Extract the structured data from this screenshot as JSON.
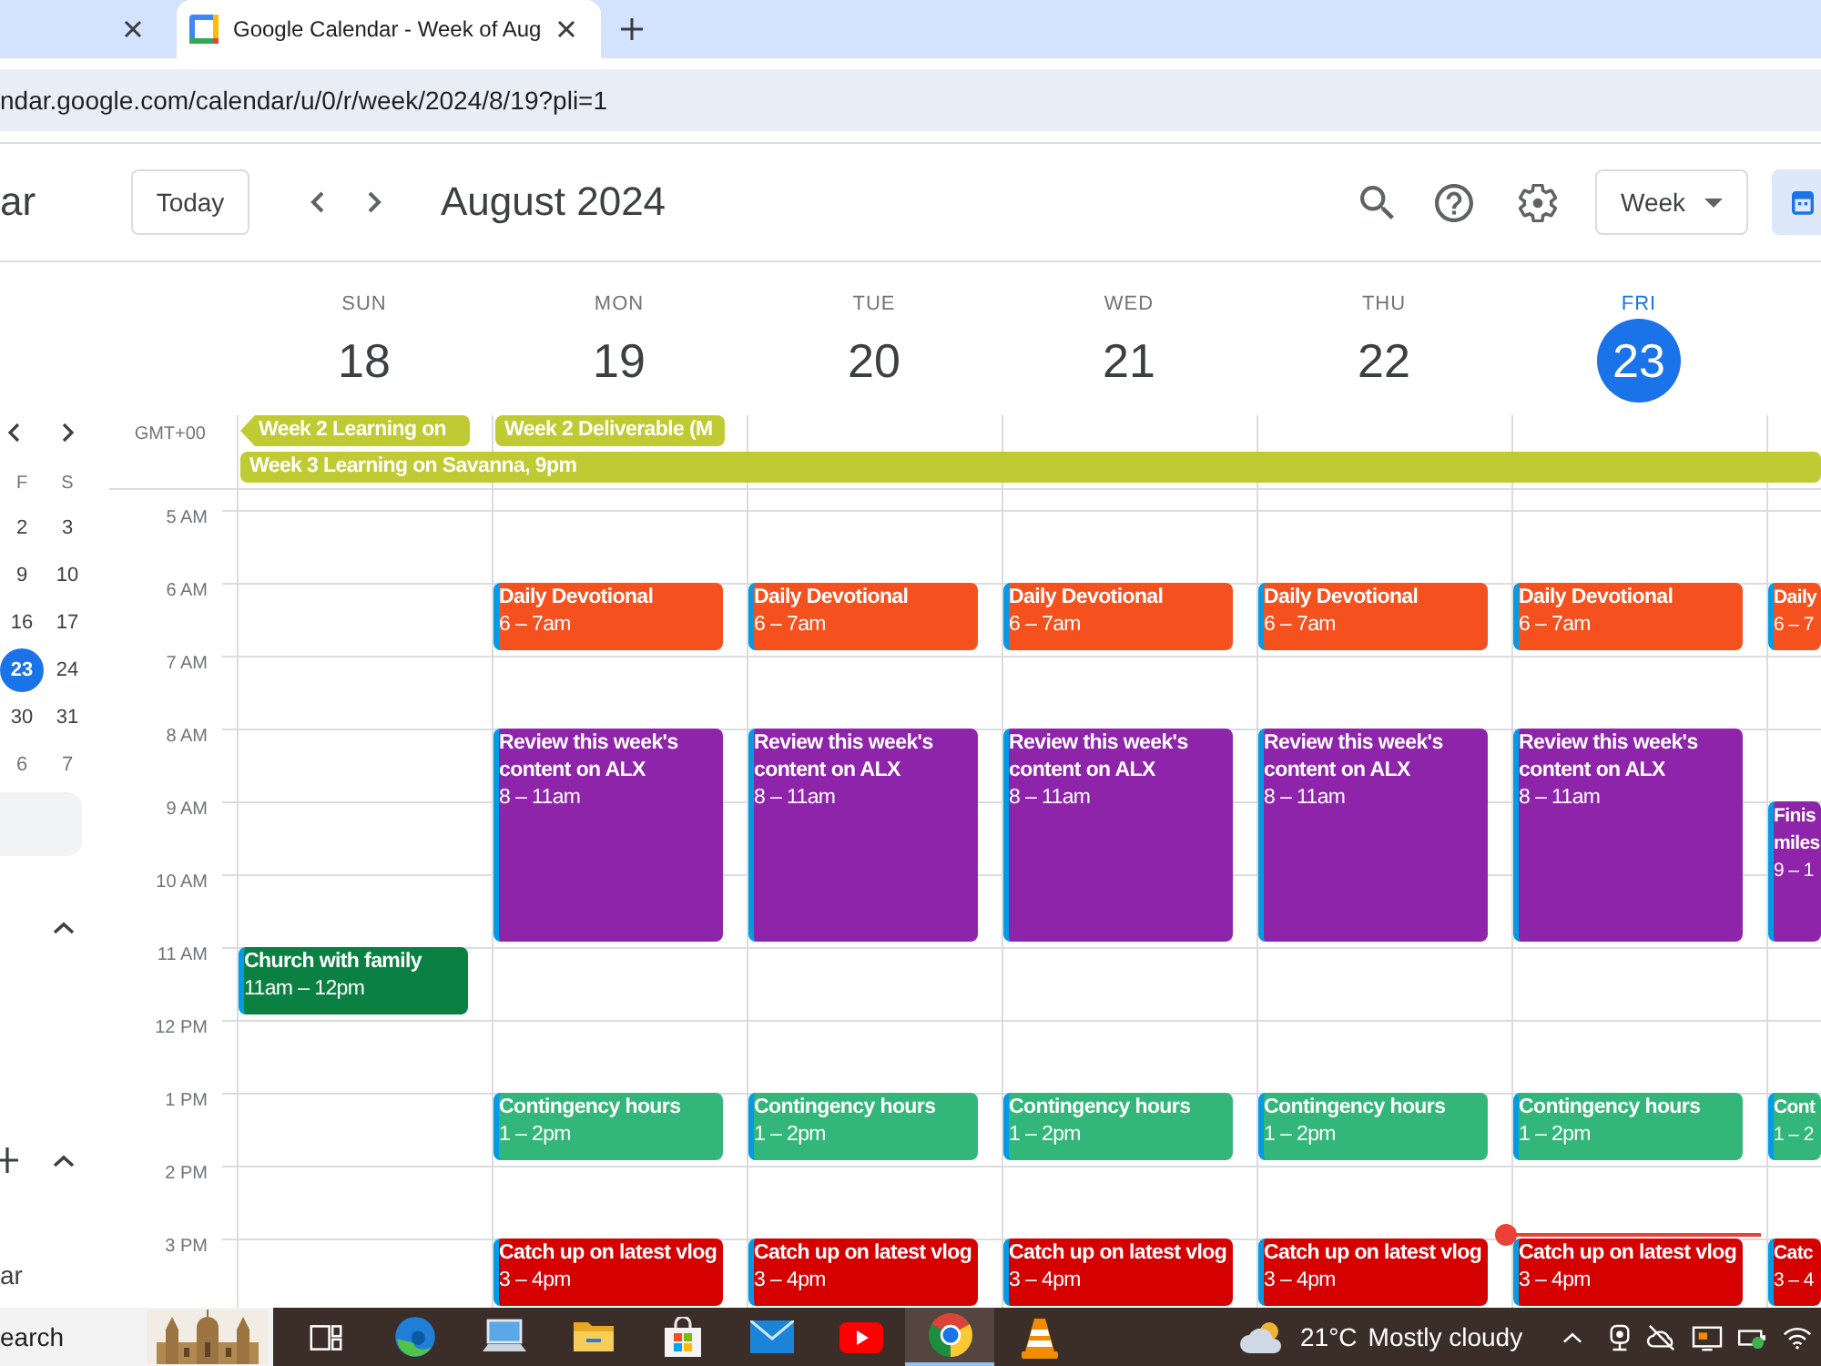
{
  "browser": {
    "tabs": [
      {
        "selected": false
      },
      {
        "title": "Google Calendar - Week of Aug",
        "selected": true
      }
    ],
    "url": "ndar.google.com/calendar/u/0/r/week/2024/8/19?pli=1"
  },
  "header": {
    "app_name": "ar",
    "today_button": "Today",
    "title": "August 2024",
    "view": "Week"
  },
  "sidebar": {
    "mini_calendar": {
      "weekdays": [
        "F",
        "S"
      ],
      "weeks": [
        [
          {
            "day": "2",
            "today": false,
            "other_month": false
          },
          {
            "day": "3",
            "today": false,
            "other_month": false
          }
        ],
        [
          {
            "day": "9",
            "today": false,
            "other_month": false
          },
          {
            "day": "10",
            "today": false,
            "other_month": false
          }
        ],
        [
          {
            "day": "16",
            "today": false,
            "other_month": false
          },
          {
            "day": "17",
            "today": false,
            "other_month": false
          }
        ],
        [
          {
            "day": "23",
            "today": true,
            "other_month": false
          },
          {
            "day": "24",
            "today": false,
            "other_month": false
          }
        ],
        [
          {
            "day": "30",
            "today": false,
            "other_month": false
          },
          {
            "day": "31",
            "today": false,
            "other_month": false
          }
        ],
        [
          {
            "day": "6",
            "today": false,
            "other_month": true
          },
          {
            "day": "7",
            "today": false,
            "other_month": true
          }
        ]
      ]
    },
    "section_label": "ar"
  },
  "week": {
    "timezone": "GMT+00",
    "hours": [
      {
        "label": "5 AM",
        "current": false
      },
      {
        "label": "6 AM",
        "current": false
      },
      {
        "label": "7 AM",
        "current": false
      },
      {
        "label": "8 AM",
        "current": false
      },
      {
        "label": "9 AM",
        "current": false
      },
      {
        "label": "10 AM",
        "current": false
      },
      {
        "label": "11 AM",
        "current": false
      },
      {
        "label": "12 PM",
        "current": false
      },
      {
        "label": "1 PM",
        "current": false
      },
      {
        "label": "2 PM",
        "current": false
      },
      {
        "label": "3 PM",
        "current": true
      }
    ],
    "all_day_rows": [
      [
        {
          "kind": "event",
          "title": "Week 2 Learning on",
          "continues_before": true
        },
        {
          "kind": "event",
          "title": "Week 2 Deliverable (M",
          "continues_before": false
        },
        {
          "kind": "empty"
        },
        {
          "kind": "empty"
        },
        {
          "kind": "empty"
        },
        {
          "kind": "empty"
        },
        {
          "kind": "empty"
        }
      ],
      [
        {
          "kind": "event",
          "title": "Week 3 Learning on Savanna, 9pm",
          "continues_before": false
        },
        {
          "kind": "continued"
        },
        {
          "kind": "continued"
        },
        {
          "kind": "continued"
        },
        {
          "kind": "continued"
        },
        {
          "kind": "continued"
        },
        {
          "kind": "continued"
        }
      ]
    ],
    "days": [
      {
        "weekday": "SUN",
        "date": "18",
        "today": false,
        "slots": [
          {
            "kind": "empty"
          },
          {
            "kind": "empty"
          },
          {
            "kind": "empty"
          },
          {
            "kind": "empty"
          },
          {
            "kind": "empty"
          },
          {
            "kind": "empty"
          },
          {
            "kind": "event",
            "title": "Church with family",
            "time": "11am – 12pm",
            "color": "#0b8043"
          },
          {
            "kind": "empty"
          },
          {
            "kind": "empty"
          },
          {
            "kind": "empty"
          },
          {
            "kind": "empty"
          }
        ]
      },
      {
        "weekday": "MON",
        "date": "19",
        "today": false,
        "slots": [
          {
            "kind": "empty"
          },
          {
            "kind": "event",
            "title": "Daily Devotional",
            "time": "6 – 7am",
            "color": "#f4511e"
          },
          {
            "kind": "empty"
          },
          {
            "kind": "event",
            "title": "Review this week's content on ALX",
            "time": "8 – 11am",
            "color": "#8e24aa"
          },
          {
            "kind": "continued"
          },
          {
            "kind": "continued"
          },
          {
            "kind": "empty"
          },
          {
            "kind": "empty"
          },
          {
            "kind": "event",
            "title": "Contingency hours",
            "time": "1 – 2pm",
            "color": "#33b679"
          },
          {
            "kind": "empty"
          },
          {
            "kind": "event",
            "title": "Catch up on latest vlog",
            "time": "3 – 4pm",
            "color": "#d50000"
          }
        ]
      },
      {
        "weekday": "TUE",
        "date": "20",
        "today": false,
        "slots": [
          {
            "kind": "empty"
          },
          {
            "kind": "event",
            "title": "Daily Devotional",
            "time": "6 – 7am",
            "color": "#f4511e"
          },
          {
            "kind": "empty"
          },
          {
            "kind": "event",
            "title": "Review this week's content on ALX",
            "time": "8 – 11am",
            "color": "#8e24aa"
          },
          {
            "kind": "continued"
          },
          {
            "kind": "continued"
          },
          {
            "kind": "empty"
          },
          {
            "kind": "empty"
          },
          {
            "kind": "event",
            "title": "Contingency hours",
            "time": "1 – 2pm",
            "color": "#33b679"
          },
          {
            "kind": "empty"
          },
          {
            "kind": "event",
            "title": "Catch up on latest vlog",
            "time": "3 – 4pm",
            "color": "#d50000"
          }
        ]
      },
      {
        "weekday": "WED",
        "date": "21",
        "today": false,
        "slots": [
          {
            "kind": "empty"
          },
          {
            "kind": "event",
            "title": "Daily Devotional",
            "time": "6 – 7am",
            "color": "#f4511e"
          },
          {
            "kind": "empty"
          },
          {
            "kind": "event",
            "title": "Review this week's content on ALX",
            "time": "8 – 11am",
            "color": "#8e24aa"
          },
          {
            "kind": "continued"
          },
          {
            "kind": "continued"
          },
          {
            "kind": "empty"
          },
          {
            "kind": "empty"
          },
          {
            "kind": "event",
            "title": "Contingency hours",
            "time": "1 – 2pm",
            "color": "#33b679"
          },
          {
            "kind": "empty"
          },
          {
            "kind": "event",
            "title": "Catch up on latest vlog",
            "time": "3 – 4pm",
            "color": "#d50000"
          }
        ]
      },
      {
        "weekday": "THU",
        "date": "22",
        "today": false,
        "slots": [
          {
            "kind": "empty"
          },
          {
            "kind": "event",
            "title": "Daily Devotional",
            "time": "6 – 7am",
            "color": "#f4511e"
          },
          {
            "kind": "empty"
          },
          {
            "kind": "event",
            "title": "Review this week's content on ALX",
            "time": "8 – 11am",
            "color": "#8e24aa"
          },
          {
            "kind": "continued"
          },
          {
            "kind": "continued"
          },
          {
            "kind": "empty"
          },
          {
            "kind": "empty"
          },
          {
            "kind": "event",
            "title": "Contingency hours",
            "time": "1 – 2pm",
            "color": "#33b679"
          },
          {
            "kind": "empty"
          },
          {
            "kind": "event",
            "title": "Catch up on latest vlog",
            "time": "3 – 4pm",
            "color": "#d50000"
          }
        ]
      },
      {
        "weekday": "FRI",
        "date": "23",
        "today": true,
        "slots": [
          {
            "kind": "empty"
          },
          {
            "kind": "event",
            "title": "Daily Devotional",
            "time": "6 – 7am",
            "color": "#f4511e"
          },
          {
            "kind": "empty"
          },
          {
            "kind": "event",
            "title": "Review this week's content on ALX",
            "time": "8 – 11am",
            "color": "#8e24aa"
          },
          {
            "kind": "continued"
          },
          {
            "kind": "continued"
          },
          {
            "kind": "empty"
          },
          {
            "kind": "empty"
          },
          {
            "kind": "event",
            "title": "Contingency hours",
            "time": "1 – 2pm",
            "color": "#33b679"
          },
          {
            "kind": "empty"
          },
          {
            "kind": "event",
            "title": "Catch up on latest vlog",
            "time": "3 – 4pm",
            "color": "#d50000"
          }
        ]
      },
      {
        "slots": [
          {
            "kind": "empty"
          },
          {
            "kind": "event",
            "title": "Daily",
            "time": "6 – 7",
            "color": "#f4511e"
          },
          {
            "kind": "empty"
          },
          {
            "kind": "empty"
          },
          {
            "kind": "event",
            "title": "Finis miles",
            "time": "9 – 1",
            "color": "#8e24aa"
          },
          {
            "kind": "continued"
          },
          {
            "kind": "empty"
          },
          {
            "kind": "empty"
          },
          {
            "kind": "event",
            "title": "Cont",
            "time": "1 – 2",
            "color": "#33b679"
          },
          {
            "kind": "empty"
          },
          {
            "kind": "event",
            "title": "Catc",
            "time": "3 – 4",
            "color": "#d50000"
          }
        ]
      }
    ]
  },
  "taskbar": {
    "search_text": "earch",
    "apps": [
      {
        "kind": "task_view",
        "active": false
      },
      {
        "kind": "edge",
        "active": false
      },
      {
        "kind": "laptop",
        "active": false
      },
      {
        "kind": "folder",
        "active": false
      },
      {
        "kind": "store",
        "active": false
      },
      {
        "kind": "mail",
        "active": false
      },
      {
        "kind": "youtube",
        "active": false
      },
      {
        "kind": "chrome",
        "active": true
      },
      {
        "kind": "vlc",
        "active": false
      }
    ],
    "weather": {
      "temperature": "21°C",
      "condition": "Mostly cloudy"
    }
  }
}
